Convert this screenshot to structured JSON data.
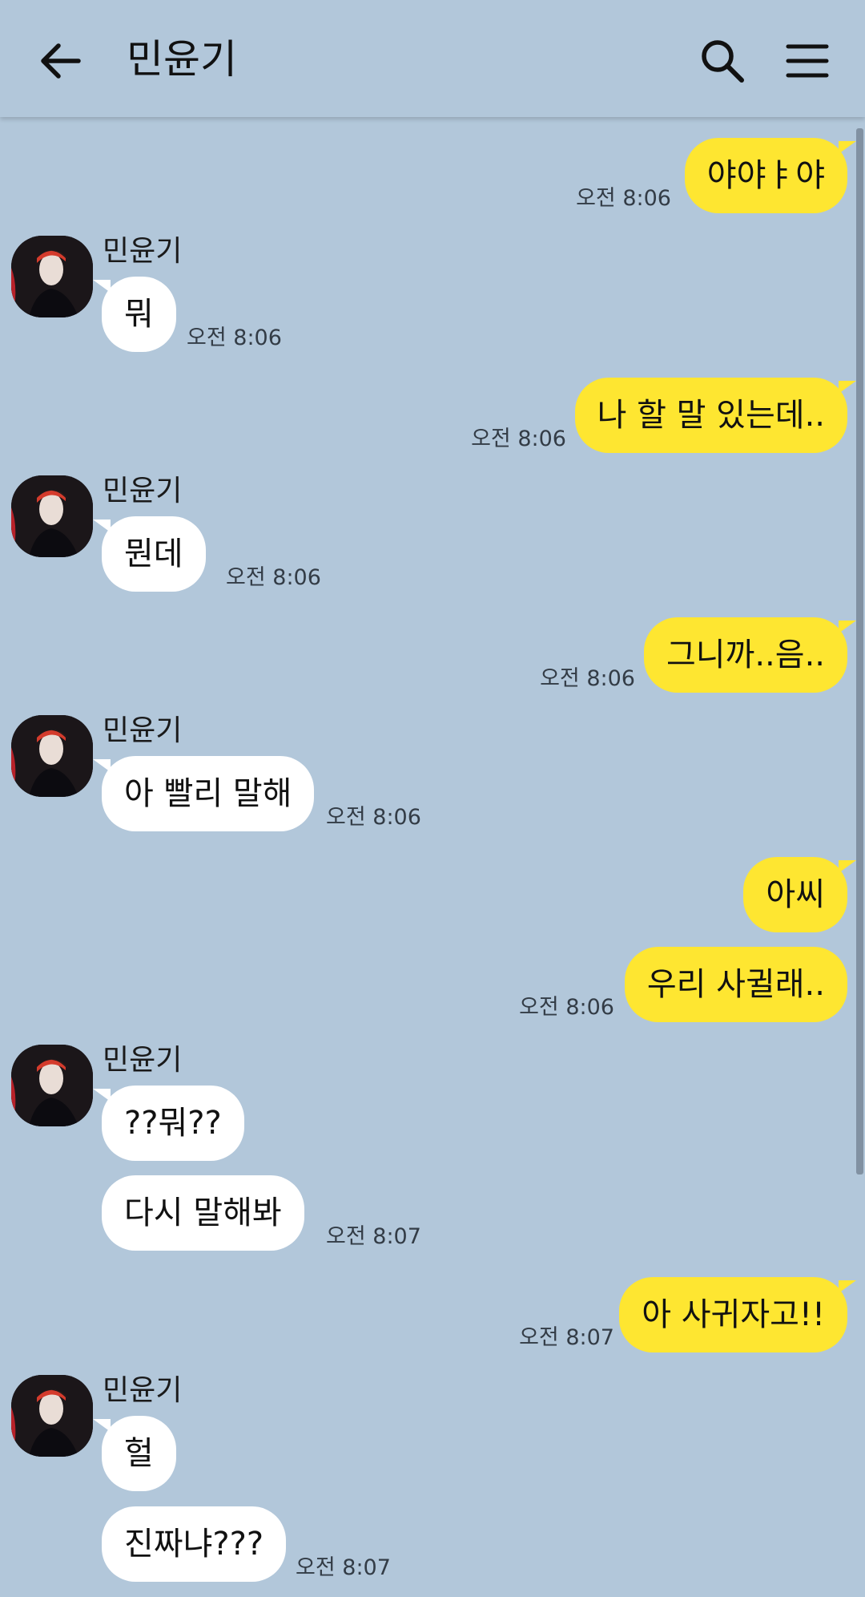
{
  "header": {
    "title": "민윤기",
    "back_icon": "arrow-left-icon",
    "search_icon": "search-icon",
    "menu_icon": "hamburger-menu-icon"
  },
  "colors": {
    "background": "#b2c7da",
    "my_bubble": "#fee631",
    "their_bubble": "#ffffff"
  },
  "messages": [
    {
      "from": "me",
      "text": "야야ㅑ야",
      "time": "오전 8:06"
    },
    {
      "from": "민윤기",
      "text": "뭐",
      "time": "오전 8:06"
    },
    {
      "from": "me",
      "text": "나 할 말 있는데..",
      "time": "오전 8:06"
    },
    {
      "from": "민윤기",
      "text": "뭔데",
      "time": "오전 8:06"
    },
    {
      "from": "me",
      "text": "그니까..음..",
      "time": "오전 8:06"
    },
    {
      "from": "민윤기",
      "text": "아 빨리 말해",
      "time": "오전 8:06"
    },
    {
      "from": "me",
      "text": "아씨"
    },
    {
      "from": "me",
      "text": "우리 사귈래..",
      "time": "오전 8:06"
    },
    {
      "from": "민윤기",
      "text": "??뭐??"
    },
    {
      "from": "민윤기",
      "text": "다시 말해봐",
      "time": "오전 8:07"
    },
    {
      "from": "me",
      "text": "아 사귀자고!!",
      "time": "오전 8:07"
    },
    {
      "from": "민윤기",
      "text": "헐"
    },
    {
      "from": "민윤기",
      "text": "진짜냐???",
      "time": "오전 8:07"
    }
  ]
}
